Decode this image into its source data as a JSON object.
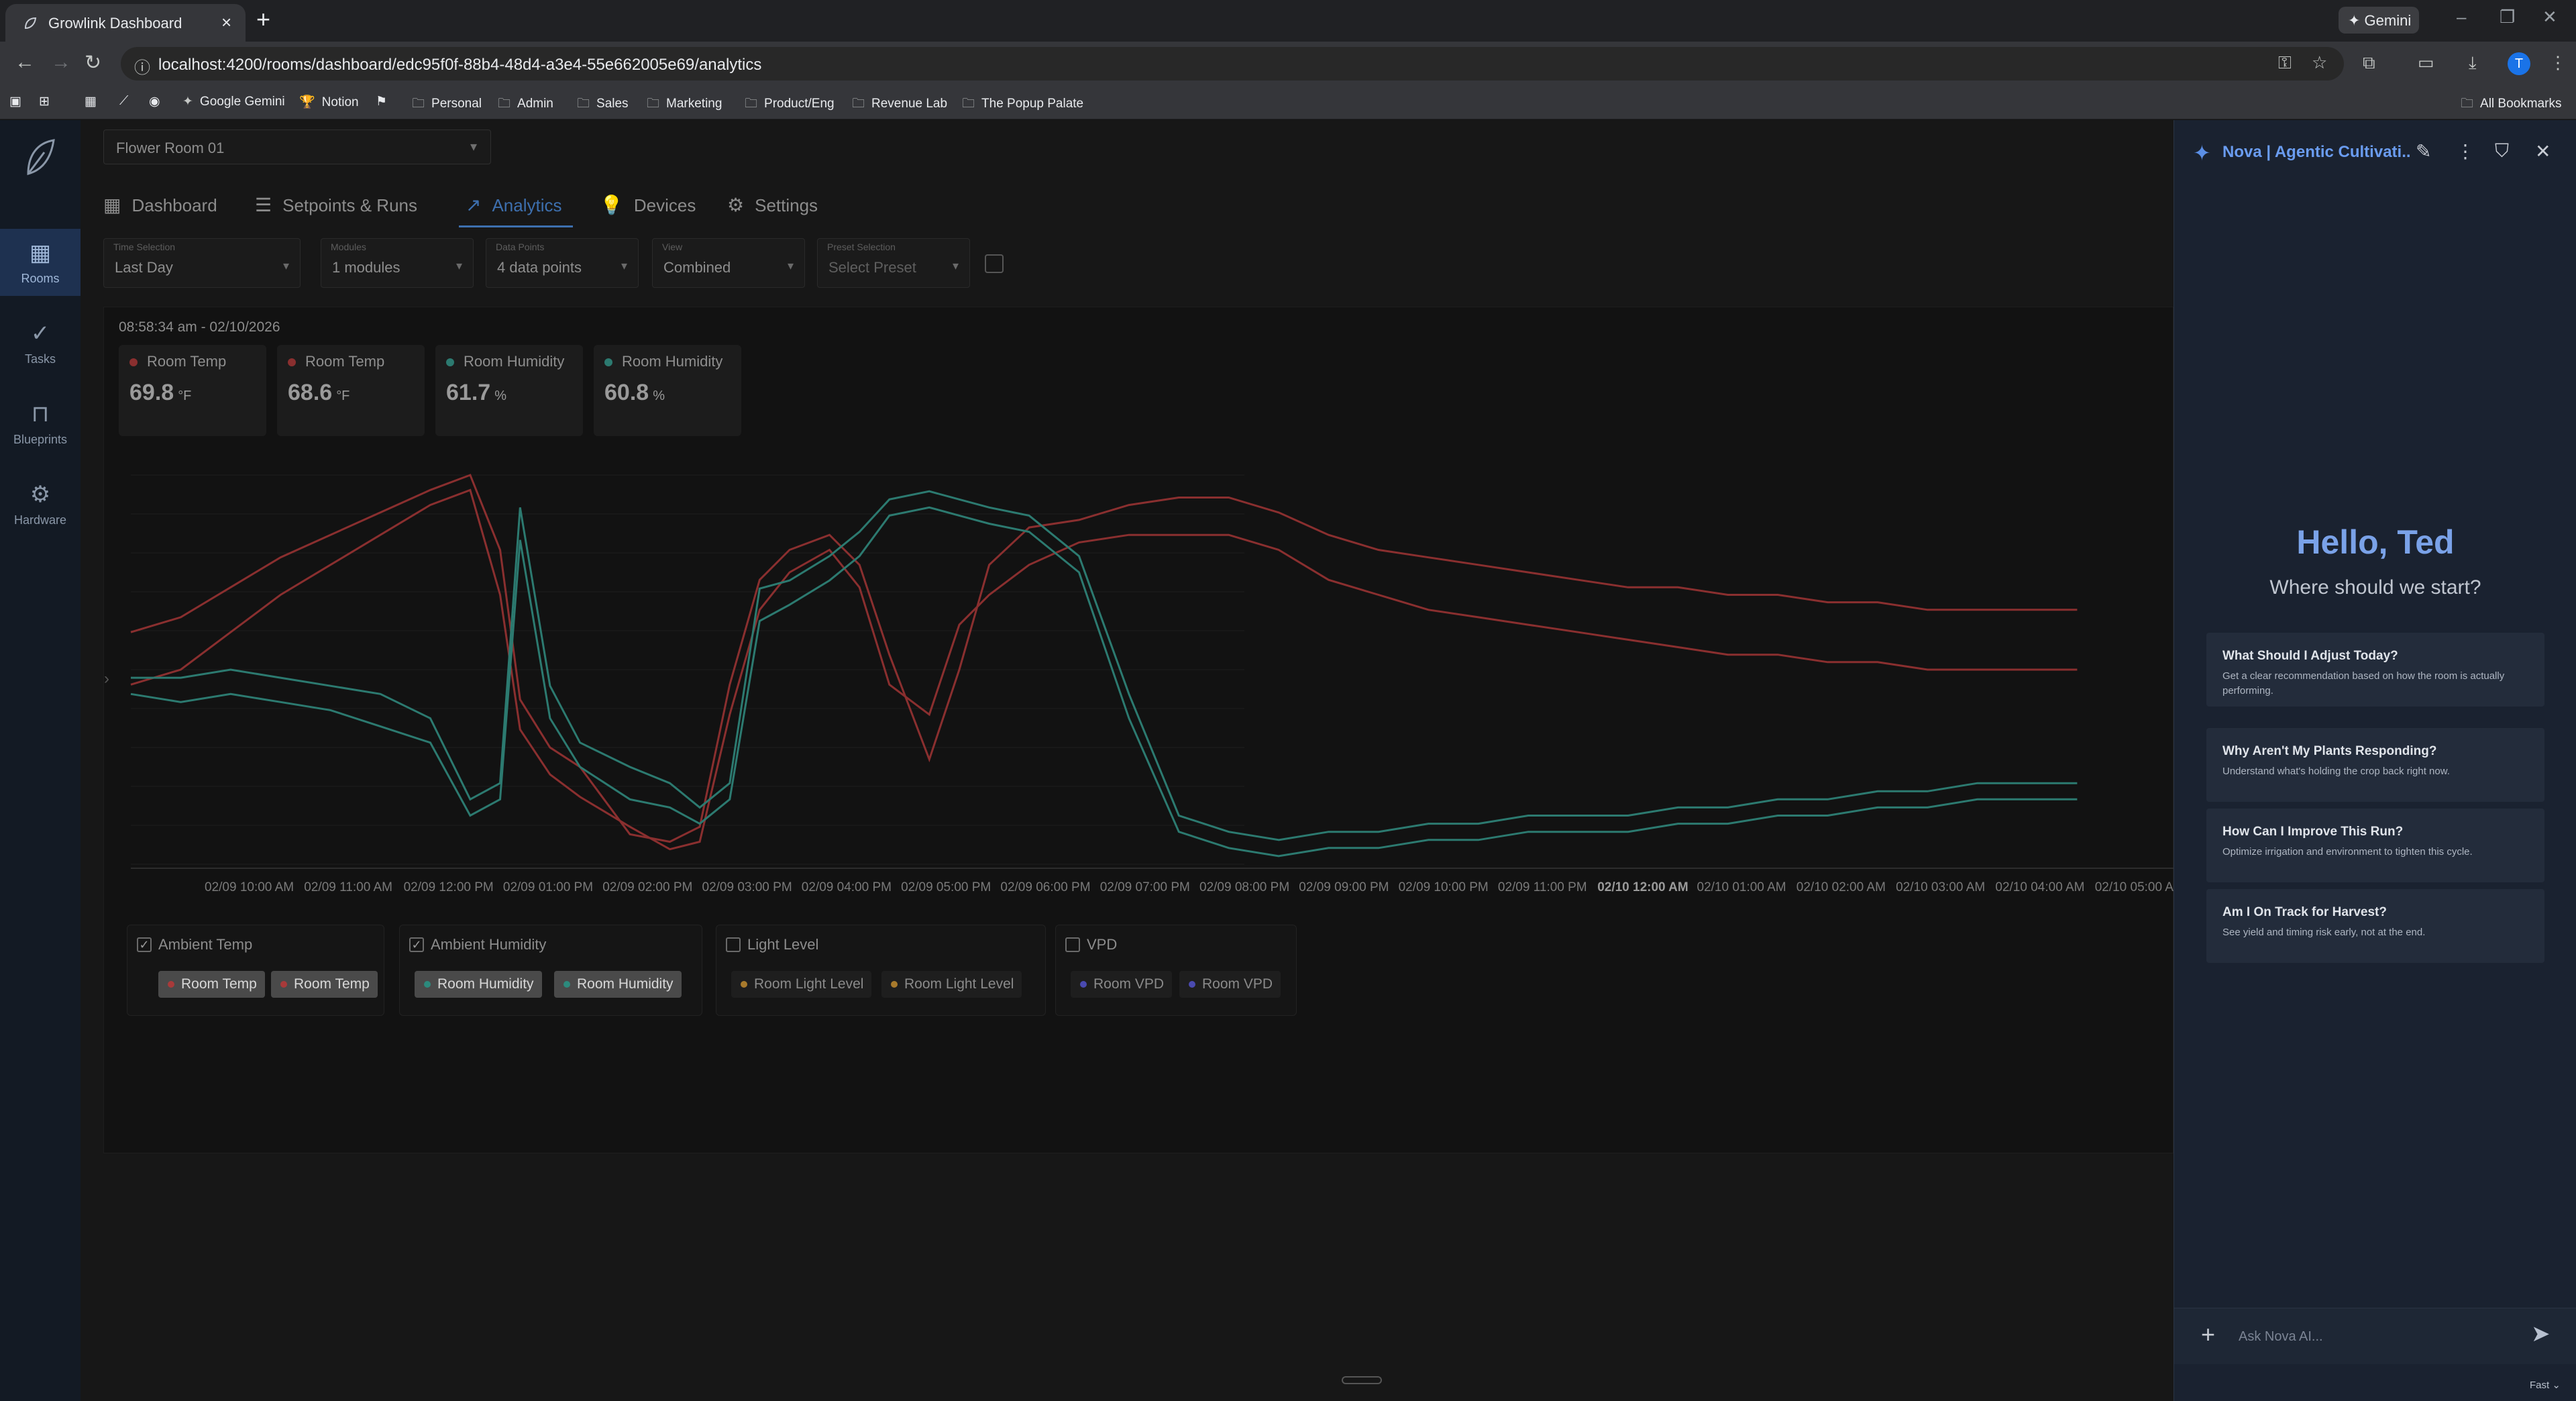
{
  "browser": {
    "tab_title": "Growlink Dashboard",
    "new_tab": "+",
    "gemini_label": "✦ Gemini",
    "url": "localhost:4200/rooms/dashboard/edc95f0f-88b4-48d4-a3e4-55e662005e69/analytics",
    "profile_initial": "T",
    "bookmarks": [
      {
        "label": "Google Gemini",
        "icon": "gemini-icon"
      },
      {
        "label": "Notion",
        "icon": "trophy-icon"
      },
      {
        "label": "Personal",
        "icon": "folder-icon"
      },
      {
        "label": "Admin",
        "icon": "folder-icon"
      },
      {
        "label": "Sales",
        "icon": "folder-icon"
      },
      {
        "label": "Marketing",
        "icon": "folder-icon"
      },
      {
        "label": "Product/Eng",
        "icon": "folder-icon"
      },
      {
        "label": "Revenue Lab",
        "icon": "folder-icon"
      },
      {
        "label": "The Popup Palate",
        "icon": "folder-icon"
      }
    ],
    "all_bookmarks": "All Bookmarks"
  },
  "nav": {
    "items": [
      {
        "label": "Rooms",
        "icon": "grid-icon",
        "active": true
      },
      {
        "label": "Tasks",
        "icon": "task-check-icon",
        "active": false
      },
      {
        "label": "Blueprints",
        "icon": "blueprint-icon",
        "active": false
      },
      {
        "label": "Hardware",
        "icon": "gear-icon",
        "active": false
      }
    ]
  },
  "room": {
    "selected": "Flower Room 01"
  },
  "tabs": [
    {
      "label": "Dashboard",
      "icon": "dashboard-icon"
    },
    {
      "label": "Setpoints & Runs",
      "icon": "sliders-icon"
    },
    {
      "label": "Analytics",
      "icon": "trend-icon",
      "active": true
    },
    {
      "label": "Devices",
      "icon": "bulb-icon"
    },
    {
      "label": "Settings",
      "icon": "gear-icon"
    }
  ],
  "filters": {
    "time": {
      "label": "Time Selection",
      "value": "Last Day"
    },
    "modules": {
      "label": "Modules",
      "value": "1 modules"
    },
    "data_points": {
      "label": "Data Points",
      "value": "4 data points"
    },
    "view": {
      "label": "View",
      "value": "Combined"
    },
    "preset": {
      "label": "Preset Selection",
      "value": "Select Preset"
    }
  },
  "readout": {
    "timestamp": "08:58:34 am - 02/10/2026",
    "stats": [
      {
        "name": "Room Temp",
        "value": "69.8",
        "unit": "°F",
        "color": "#8a2f2f"
      },
      {
        "name": "Room Temp",
        "value": "68.6",
        "unit": "°F",
        "color": "#8a2f2f"
      },
      {
        "name": "Room Humidity",
        "value": "61.7",
        "unit": "%",
        "color": "#2c7a70"
      },
      {
        "name": "Room Humidity",
        "value": "60.8",
        "unit": "%",
        "color": "#2c7a70"
      }
    ]
  },
  "chart_data": {
    "type": "line",
    "title": "",
    "xlabel": "",
    "ylabel": "",
    "grid": true,
    "x_ticks": [
      "02/09 10:00 AM",
      "02/09 11:00 AM",
      "02/09 12:00 PM",
      "02/09 01:00 PM",
      "02/09 02:00 PM",
      "02/09 03:00 PM",
      "02/09 04:00 PM",
      "02/09 05:00 PM",
      "02/09 06:00 PM",
      "02/09 07:00 PM",
      "02/09 08:00 PM",
      "02/09 09:00 PM",
      "02/09 10:00 PM",
      "02/09 11:00 PM",
      "02/10 12:00 AM",
      "02/10 01:00 AM",
      "02/10 02:00 AM",
      "02/10 03:00 AM",
      "02/10 04:00 AM",
      "02/10 05:00 A"
    ],
    "x_ticks_bold": [
      "02/10 12:00 AM"
    ],
    "x_hours": [
      0,
      0.5,
      1,
      1.5,
      2,
      2.5,
      3,
      3.4,
      3.7,
      3.9,
      4.2,
      4.5,
      5,
      5.4,
      5.7,
      6,
      6.3,
      6.6,
      7,
      7.3,
      7.6,
      8,
      8.3,
      8.6,
      9,
      9.5,
      10,
      10.5,
      11,
      11.5,
      12,
      12.5,
      13,
      13.5,
      14,
      14.5,
      15,
      15.5,
      16,
      16.5,
      17,
      17.5,
      18,
      18.5,
      19,
      19.5
    ],
    "series": [
      {
        "name": "Room Temp",
        "color": "#8a2f2f",
        "values": [
          75.5,
          76.5,
          78.5,
          80.5,
          82,
          83.5,
          85,
          86,
          81,
          71,
          67.8,
          66.5,
          62,
          61.5,
          62.5,
          72,
          79,
          81,
          82,
          80,
          74,
          67,
          73,
          80,
          82.5,
          83,
          84,
          84.5,
          84.5,
          83.5,
          82,
          81,
          80.5,
          80,
          79.5,
          79,
          78.5,
          78.5,
          78,
          78,
          77.5,
          77.5,
          77,
          77,
          77,
          77
        ]
      },
      {
        "name": "Room Temp",
        "color": "#8a2f2f",
        "values": [
          72,
          73,
          75.5,
          78,
          80,
          82,
          84,
          85,
          78,
          69,
          66,
          64.5,
          62.5,
          61,
          61.5,
          70,
          77,
          79.5,
          81,
          78.5,
          72,
          70,
          76,
          78,
          80,
          81.5,
          82,
          82,
          82,
          81,
          79,
          78,
          77,
          76.5,
          76,
          75.5,
          75,
          74.5,
          74,
          74,
          73.5,
          73.5,
          73,
          73,
          73,
          73
        ]
      }
    ],
    "series_secondary": [
      {
        "name": "Room Humidity",
        "color": "#2c7a70",
        "values": [
          62.5,
          62.5,
          63,
          62.5,
          62,
          61.5,
          60,
          55,
          56,
          73,
          62,
          58.5,
          57,
          56,
          54.5,
          56,
          68,
          68.5,
          70,
          71.5,
          73.5,
          74,
          73.5,
          73,
          72.5,
          70,
          61.5,
          54,
          53,
          52.5,
          53,
          53,
          53.5,
          53.5,
          54,
          54,
          54,
          54.5,
          54.5,
          55,
          55,
          55.5,
          55.5,
          56,
          56,
          56
        ]
      },
      {
        "name": "Room Humidity",
        "color": "#2c7a70",
        "values": [
          61.5,
          61,
          61.5,
          61,
          60.5,
          59.5,
          58.5,
          54,
          55,
          71,
          60,
          57,
          55,
          54.5,
          53.5,
          55,
          66,
          67,
          68.5,
          70,
          72.5,
          73,
          72.5,
          72,
          71.5,
          69,
          60,
          53,
          52,
          51.5,
          52,
          52,
          52.5,
          52.5,
          53,
          53,
          53,
          53.5,
          53.5,
          54,
          54,
          54.5,
          54.5,
          55,
          55,
          55
        ]
      }
    ]
  },
  "legend_groups": [
    {
      "label": "Ambient Temp",
      "checked": true,
      "chips": [
        {
          "label": "Room Temp",
          "color": "#a83a3a",
          "on": true
        },
        {
          "label": "Room Temp",
          "color": "#a83a3a",
          "on": true
        }
      ]
    },
    {
      "label": "Ambient Humidity",
      "checked": true,
      "chips": [
        {
          "label": "Room Humidity",
          "color": "#2c8a7d",
          "on": true
        },
        {
          "label": "Room Humidity",
          "color": "#2c8a7d",
          "on": true
        }
      ]
    },
    {
      "label": "Light Level",
      "checked": false,
      "chips": [
        {
          "label": "Room Light Level",
          "color": "#a87a2c",
          "on": false
        },
        {
          "label": "Room Light Level",
          "color": "#a87a2c",
          "on": false
        }
      ]
    },
    {
      "label": "VPD",
      "checked": false,
      "chips": [
        {
          "label": "Room VPD",
          "color": "#4a4ab0",
          "on": false
        },
        {
          "label": "Room VPD",
          "color": "#4a4ab0",
          "on": false
        }
      ]
    }
  ],
  "nova": {
    "title": "Nova | Agentic Cultivati...",
    "greeting": "Hello, Ted",
    "subtitle": "Where should we start?",
    "suggestions": [
      {
        "title": "What Should I Adjust Today?",
        "desc": "Get a clear recommendation based on how the room is actually performing."
      },
      {
        "title": "Why Aren't My Plants Responding?",
        "desc": "Understand what's holding the crop back right now."
      },
      {
        "title": "How Can I Improve This Run?",
        "desc": "Optimize irrigation and environment to tighten this cycle."
      },
      {
        "title": "Am I On Track for Harvest?",
        "desc": "See yield and timing risk early, not at the end."
      }
    ],
    "input_placeholder": "Ask Nova AI...",
    "mode": "Fast ⌄"
  }
}
